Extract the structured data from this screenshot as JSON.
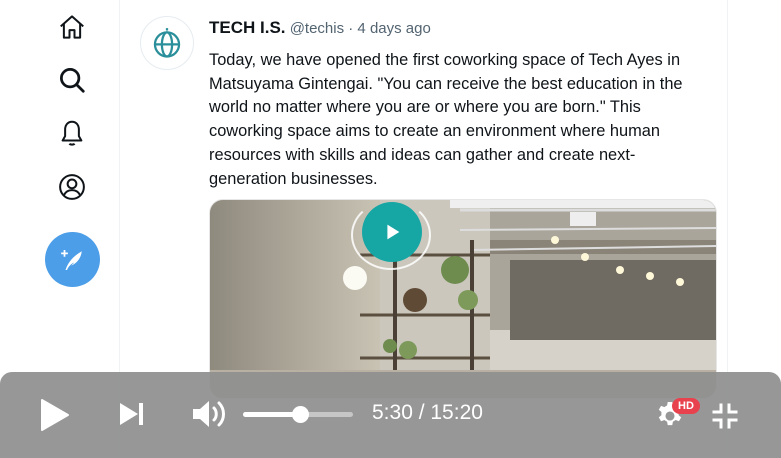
{
  "nav": {
    "items": [
      {
        "name": "home",
        "icon": "home-icon"
      },
      {
        "name": "search",
        "icon": "search-icon"
      },
      {
        "name": "notifications",
        "icon": "bell-icon"
      },
      {
        "name": "profile",
        "icon": "user-circle-icon"
      }
    ],
    "compose_icon": "feather-icon",
    "compose_color": "#4c9ee8"
  },
  "tweet": {
    "author": "TECH I.S.",
    "meta": "@techis · 4 days ago",
    "text": "Today, we have opened the first coworking space of Tech Ayes in Matsuyama Gintengai. \"You can receive the best education in the world no matter where you are or where you are born.\" This coworking space aims to create an environment where human resources with skills and ideas can gather and create next-generation businesses.",
    "avatar_icon": "globe-icon",
    "media_play_color": "#16a7a4"
  },
  "player": {
    "time": "5:30 / 15:20",
    "volume_fraction": 0.52,
    "quality_badge": "HD",
    "badge_color": "#e8424e",
    "icons": [
      "play-icon",
      "skip-next-icon",
      "volume-icon",
      "settings-gear-icon",
      "exit-fullscreen-icon"
    ]
  }
}
